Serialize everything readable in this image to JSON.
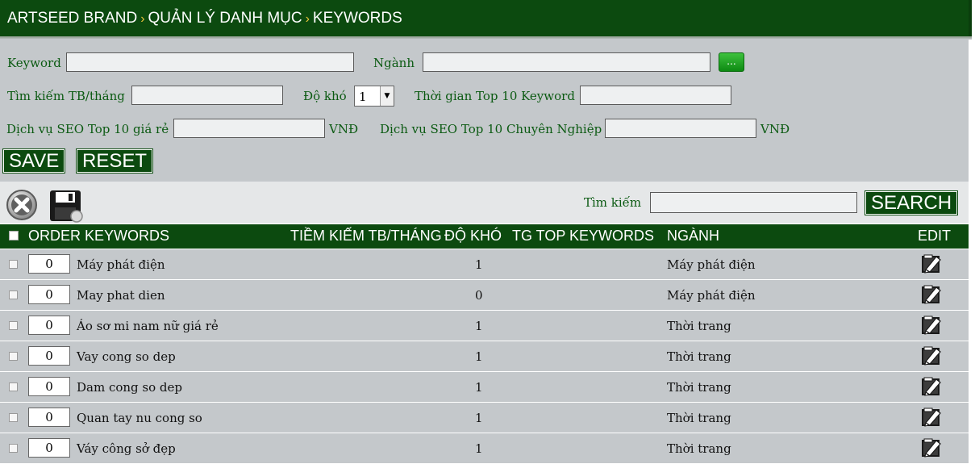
{
  "breadcrumb": {
    "items": [
      "ARTSEED BRAND",
      "QUẢN LÝ DANH MỤC",
      "KEYWORDS"
    ],
    "separator": "›"
  },
  "form": {
    "keyword_label": "Keyword",
    "keyword_value": "",
    "nganh_label": "Ngành",
    "nganh_value": "",
    "dots_button_label": "...",
    "search_tb_label": "Tìm kiếm TB/tháng",
    "search_tb_value": "",
    "do_kho_label": "Độ khó",
    "do_kho_selected": "1",
    "top10_time_label": "Thời gian Top 10 Keyword",
    "top10_time_value": "",
    "seo_cheap_label": "Dịch vụ SEO Top 10 giá rẻ",
    "seo_cheap_value": "",
    "currency_1": "VNĐ",
    "seo_pro_label": "Dịch vụ SEO Top 10 Chuyên Nghiệp",
    "seo_pro_value": "",
    "currency_2": "VNĐ",
    "save_label": "SAVE",
    "reset_label": "RESET"
  },
  "toolbar": {
    "search_label": "Tìm kiếm",
    "search_value": "",
    "search_button": "SEARCH"
  },
  "table": {
    "headers": {
      "order_keywords": "ORDER KEYWORDS",
      "tiem_kiem": "TIỀM KIẾM TB/THÁNG",
      "do_kho": "ĐỘ KHÓ",
      "tg_top": "TG TOP KEYWORDS",
      "nganh": "NGÀNH",
      "edit": "EDIT"
    },
    "rows": [
      {
        "order": "0",
        "keyword": "Máy phát điện",
        "do_kho": "1",
        "nganh": "Máy phát điện"
      },
      {
        "order": "0",
        "keyword": "May phat dien",
        "do_kho": "0",
        "nganh": "Máy phát điện"
      },
      {
        "order": "0",
        "keyword": "Áo sơ mi nam nữ giá rẻ",
        "do_kho": "1",
        "nganh": "Thời trang"
      },
      {
        "order": "0",
        "keyword": "Vay cong so dep",
        "do_kho": "1",
        "nganh": "Thời trang"
      },
      {
        "order": "0",
        "keyword": "Dam cong so dep",
        "do_kho": "1",
        "nganh": "Thời trang"
      },
      {
        "order": "0",
        "keyword": "Quan tay nu cong so",
        "do_kho": "1",
        "nganh": "Thời trang"
      },
      {
        "order": "0",
        "keyword": "Váy công sở đẹp",
        "do_kho": "1",
        "nganh": "Thời trang"
      }
    ]
  },
  "icons": {
    "delete": "delete-circle-icon",
    "save": "floppy-disk-icon",
    "edit": "edit-pencil-icon"
  },
  "colors": {
    "primary": "#0c4a0f",
    "label": "#0b5a12",
    "panel": "#c4c8cb",
    "toolbar": "#e5e7e8",
    "chevron": "#e8c43a"
  }
}
